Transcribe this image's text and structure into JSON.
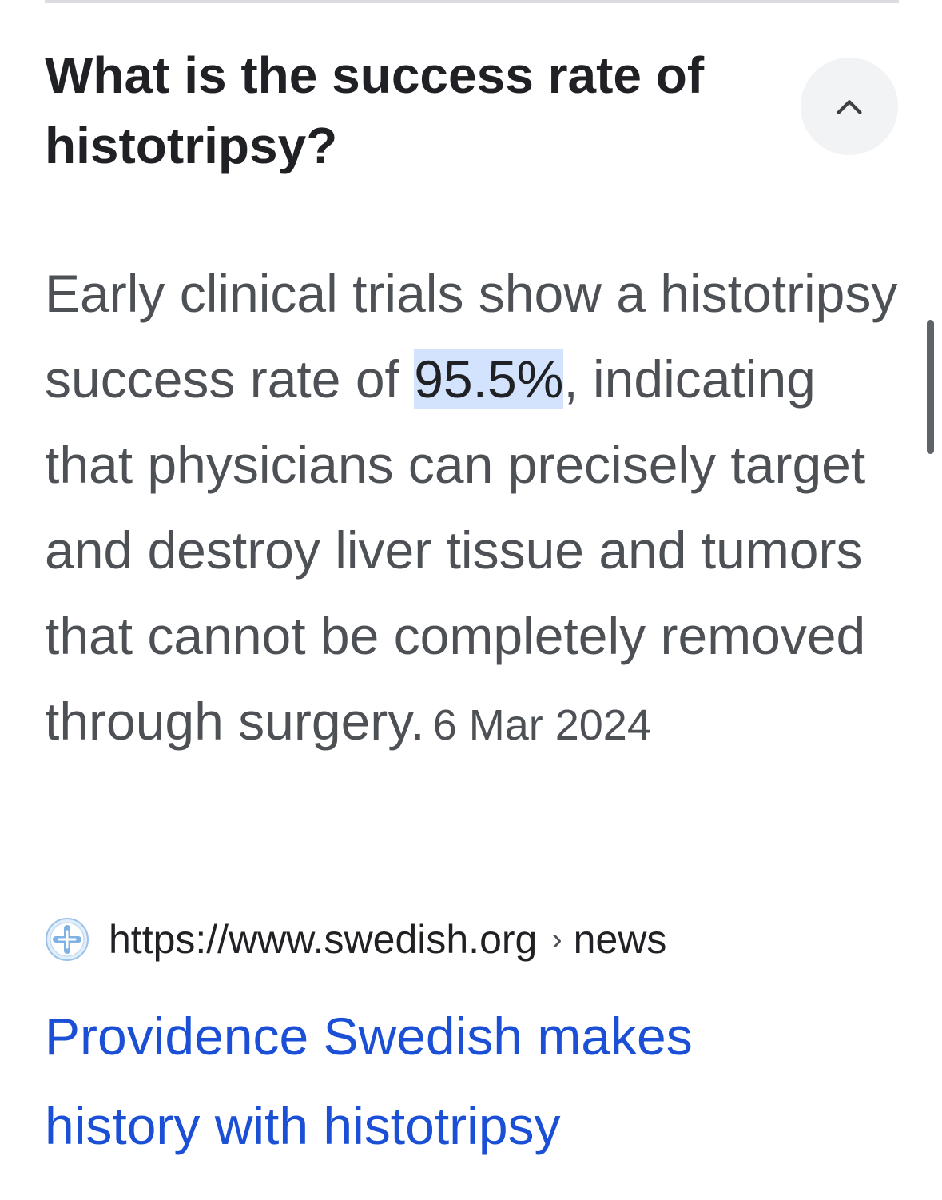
{
  "question": {
    "text": "What is the success rate of histotripsy?"
  },
  "collapse": {
    "icon": "chevron-up-icon"
  },
  "answer": {
    "text_before": "Early clinical trials show a histotripsy success rate of ",
    "highlight": "95.5%",
    "text_after": ", indicating that physicians can precisely target and destroy liver tissue and tumors that cannot be completely removed through surgery.",
    "date": "6 Mar 2024"
  },
  "source": {
    "favicon": "swedish-cross-icon",
    "url": "https://www.swedish.org",
    "separator": "›",
    "path": "news"
  },
  "result": {
    "title": "Providence Swedish makes history with histotripsy"
  },
  "colors": {
    "link": "#1a4fd6",
    "highlight": "#d3e3fd",
    "body_text": "#4d5156",
    "heading_text": "#202124"
  }
}
